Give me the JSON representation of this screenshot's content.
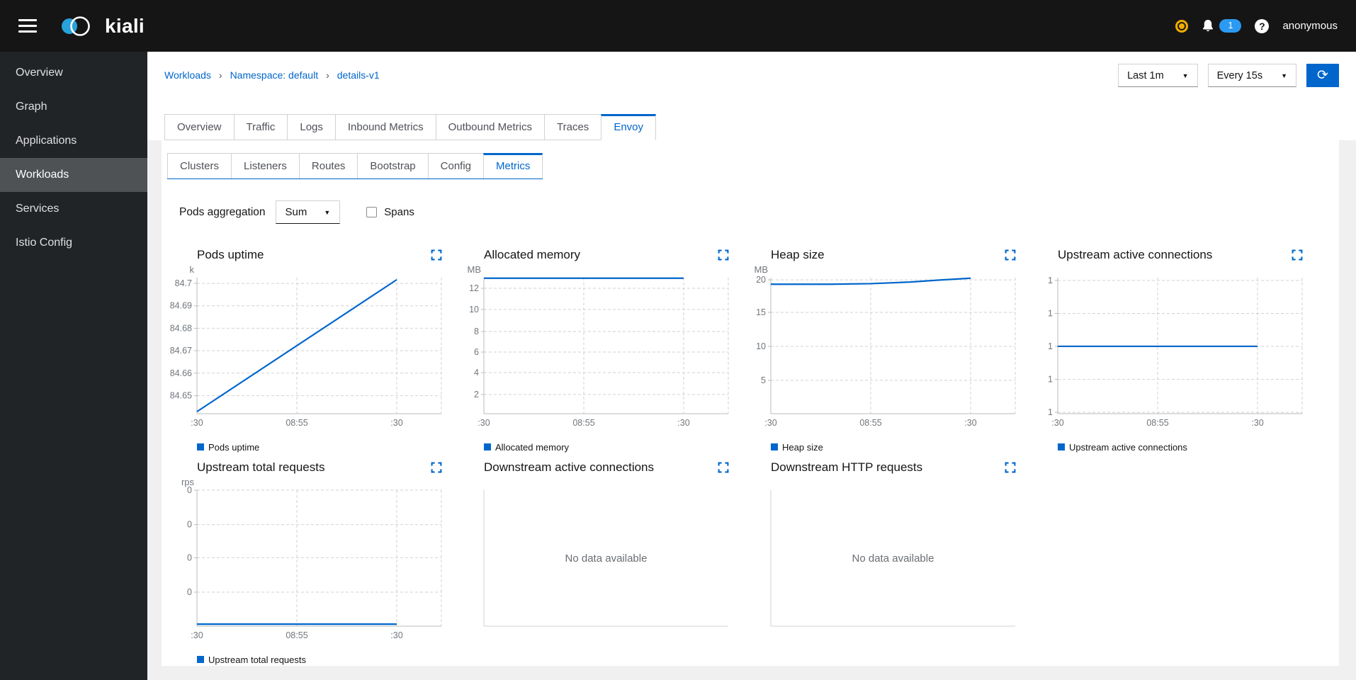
{
  "masthead": {
    "brand": "kiali",
    "user": "anonymous",
    "notifications": "1"
  },
  "icons": {
    "refresh_glyph": "⟳",
    "caret_glyph": "▼",
    "breadcrumb_separator": "›",
    "help_glyph": "?"
  },
  "colors": {
    "accent": "#0066cc",
    "line": "#0066cc",
    "masthead": "#151515",
    "sidebar": "#212427",
    "badge": "#2b9af3",
    "warning": "#f0ab00",
    "grid": "#d2d2d2",
    "axis": "#b8bbbe",
    "tick_text": "#71767b",
    "muted_text": "#6a6e73"
  },
  "sidebar": {
    "items": [
      {
        "label": "Overview",
        "active": false
      },
      {
        "label": "Graph",
        "active": false
      },
      {
        "label": "Applications",
        "active": false
      },
      {
        "label": "Workloads",
        "active": true
      },
      {
        "label": "Services",
        "active": false
      },
      {
        "label": "Istio Config",
        "active": false
      }
    ]
  },
  "breadcrumb": {
    "items": [
      "Workloads",
      "Namespace: default",
      "details-v1"
    ]
  },
  "controls": {
    "duration_value": "Last 1m",
    "refresh_value": "Every 15s"
  },
  "tabs": {
    "main": [
      {
        "label": "Overview",
        "active": false
      },
      {
        "label": "Traffic",
        "active": false
      },
      {
        "label": "Logs",
        "active": false
      },
      {
        "label": "Inbound Metrics",
        "active": false
      },
      {
        "label": "Outbound Metrics",
        "active": false
      },
      {
        "label": "Traces",
        "active": false
      },
      {
        "label": "Envoy",
        "active": true
      }
    ],
    "sub": [
      {
        "label": "Clusters",
        "active": false
      },
      {
        "label": "Listeners",
        "active": false
      },
      {
        "label": "Routes",
        "active": false
      },
      {
        "label": "Bootstrap",
        "active": false
      },
      {
        "label": "Config",
        "active": false
      },
      {
        "label": "Metrics",
        "active": true
      }
    ]
  },
  "toolbar": {
    "aggregation_label": "Pods aggregation",
    "aggregation_value": "Sum",
    "spans_label": "Spans",
    "spans_checked": false
  },
  "charts": {
    "no_data_label": "No data available"
  },
  "chart_data": [
    {
      "key": "pods-uptime",
      "type": "line",
      "title": "Pods uptime",
      "unit": "k",
      "legend": "Pods uptime",
      "x_ticks": [
        ":30",
        "08:55",
        ":30"
      ],
      "y_ticks": [
        "84.7",
        "84.69",
        "84.68",
        "84.67",
        "84.66",
        "84.65"
      ],
      "y_tick_fracs": [
        0.042,
        0.207,
        0.372,
        0.537,
        0.702,
        0.868
      ],
      "series_points": [
        [
          0,
          0.985
        ],
        [
          1,
          0.015
        ]
      ],
      "approx_values_k": [
        84.646,
        84.7
      ],
      "no_data": false
    },
    {
      "key": "allocated-memory",
      "type": "line",
      "title": "Allocated memory",
      "unit": "MB",
      "legend": "Allocated memory",
      "x_ticks": [
        ":30",
        "08:55",
        ":30"
      ],
      "y_ticks": [
        "12",
        "10",
        "8",
        "6",
        "4",
        "2"
      ],
      "y_tick_fracs": [
        0.078,
        0.234,
        0.396,
        0.547,
        0.698,
        0.859
      ],
      "series_points": [
        [
          0,
          0.004
        ],
        [
          1,
          0.004
        ]
      ],
      "approx_values_mb": [
        13.1,
        13.1
      ],
      "no_data": false
    },
    {
      "key": "heap-size",
      "type": "line",
      "title": "Heap size",
      "unit": "MB",
      "legend": "Heap size",
      "x_ticks": [
        ":30",
        "08:55",
        ":30"
      ],
      "y_ticks": [
        "20",
        "15",
        "10",
        "5"
      ],
      "y_tick_fracs": [
        0.016,
        0.255,
        0.505,
        0.755
      ],
      "series_points": [
        [
          0,
          0.048
        ],
        [
          0.3,
          0.048
        ],
        [
          0.5,
          0.044
        ],
        [
          0.7,
          0.032
        ],
        [
          0.85,
          0.017
        ],
        [
          1,
          0.004
        ]
      ],
      "approx_values_mb": [
        18.8,
        18.8,
        19.0,
        19.3,
        19.6,
        19.8
      ],
      "no_data": false
    },
    {
      "key": "upstream-active-connections",
      "type": "line",
      "title": "Upstream active connections",
      "unit": "",
      "legend": "Upstream active connections",
      "x_ticks": [
        ":30",
        "08:55",
        ":30"
      ],
      "y_ticks": [
        "1",
        "1",
        "1",
        "1",
        "1"
      ],
      "y_tick_fracs": [
        0.02,
        0.263,
        0.505,
        0.748,
        0.99
      ],
      "series_points": [
        [
          0,
          0.505
        ],
        [
          1,
          0.505
        ]
      ],
      "approx_values": [
        1,
        1
      ],
      "no_data": false
    },
    {
      "key": "upstream-total-requests",
      "type": "line",
      "title": "Upstream total requests",
      "unit": "rps",
      "legend": "Upstream total requests",
      "x_ticks": [
        ":30",
        "08:55",
        ":30"
      ],
      "y_ticks": [
        "0",
        "0",
        "0",
        "0"
      ],
      "y_tick_fracs": [
        0.0,
        0.253,
        0.497,
        0.75
      ],
      "series_points": [
        [
          0,
          0.985
        ],
        [
          1,
          0.985
        ]
      ],
      "approx_values_rps": [
        0,
        0
      ],
      "no_data": false
    },
    {
      "key": "downstream-active-connections",
      "type": "line",
      "title": "Downstream active connections",
      "unit": "",
      "legend": "",
      "x_ticks": [],
      "y_ticks": [],
      "y_tick_fracs": [],
      "series_points": [],
      "no_data": true
    },
    {
      "key": "downstream-http-requests",
      "type": "line",
      "title": "Downstream HTTP requests",
      "unit": "",
      "legend": "",
      "x_ticks": [],
      "y_ticks": [],
      "y_tick_fracs": [],
      "series_points": [],
      "no_data": true
    }
  ]
}
